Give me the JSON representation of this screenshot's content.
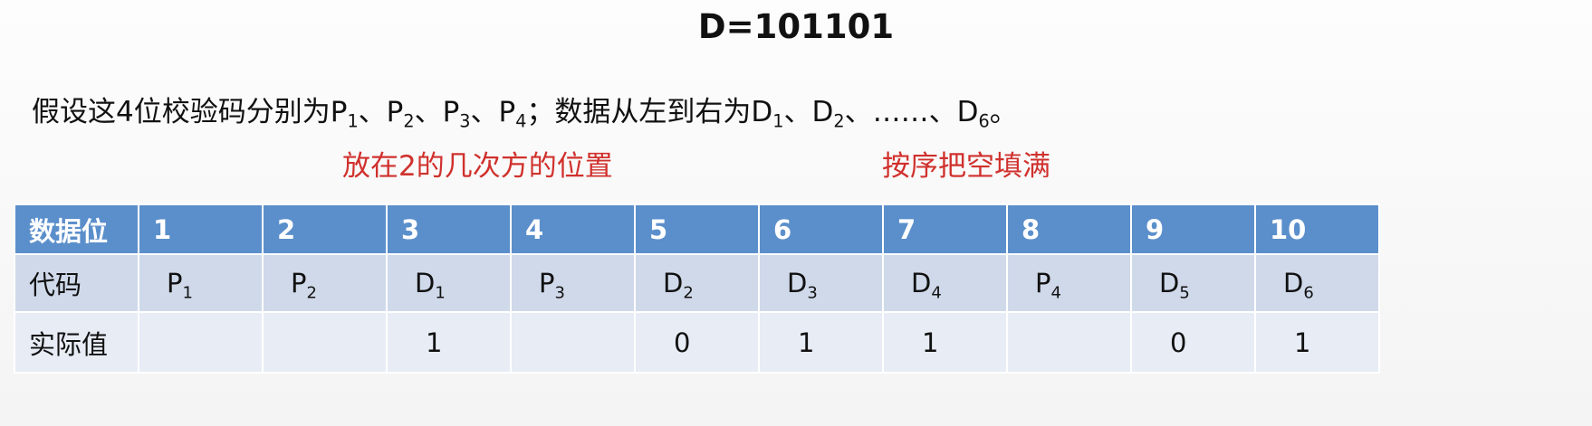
{
  "title": "D=101101",
  "description": {
    "prefix": "假设这4位校验码分别为",
    "parity": [
      {
        "base": "P",
        "sub": "1"
      },
      {
        "base": "P",
        "sub": "2"
      },
      {
        "base": "P",
        "sub": "3"
      },
      {
        "base": "P",
        "sub": "4"
      }
    ],
    "sep": "、",
    "middle": "；数据从左到右为",
    "data_first": {
      "base": "D",
      "sub": "1"
    },
    "data_second": {
      "base": "D",
      "sub": "2"
    },
    "ellipsis": "……",
    "data_last": {
      "base": "D",
      "sub": "6"
    },
    "end": "。"
  },
  "notes": {
    "left": "放在2的几次方的位置",
    "right": "按序把空填满"
  },
  "table": {
    "row_labels": [
      "数据位",
      "代码",
      "实际值"
    ],
    "positions": [
      "1",
      "2",
      "3",
      "4",
      "5",
      "6",
      "7",
      "8",
      "9",
      "10"
    ],
    "codes": [
      {
        "base": "P",
        "sub": "1"
      },
      {
        "base": "P",
        "sub": "2"
      },
      {
        "base": "D",
        "sub": "1"
      },
      {
        "base": "P",
        "sub": "3"
      },
      {
        "base": "D",
        "sub": "2"
      },
      {
        "base": "D",
        "sub": "3"
      },
      {
        "base": "D",
        "sub": "4"
      },
      {
        "base": "P",
        "sub": "4"
      },
      {
        "base": "D",
        "sub": "5"
      },
      {
        "base": "D",
        "sub": "6"
      }
    ],
    "values": [
      "",
      "",
      "1",
      "",
      "0",
      "1",
      "1",
      "",
      "0",
      "1"
    ]
  },
  "colors": {
    "header_bg": "#5b8fcb",
    "code_row_bg": "#cfd9ea",
    "value_row_bg": "#e7ecf5",
    "note_red": "#d0312d"
  }
}
